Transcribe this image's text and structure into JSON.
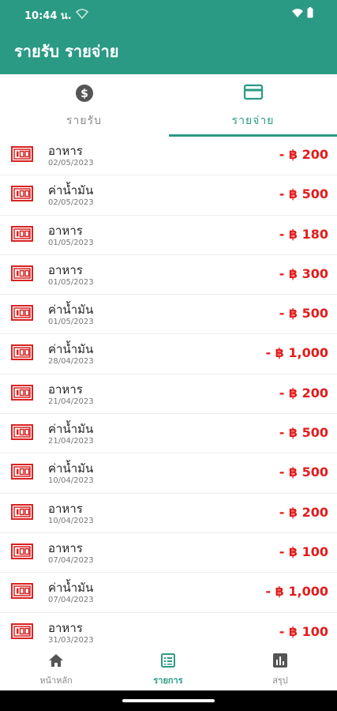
{
  "status_bar": {
    "time": "10:44 น."
  },
  "app_bar": {
    "title": "รายรับ รายจ่าย"
  },
  "tabs": [
    {
      "label": "รายรับ",
      "icon": "dollar-circle-icon",
      "active": false
    },
    {
      "label": "รายจ่าย",
      "icon": "credit-card-icon",
      "active": true
    }
  ],
  "colors": {
    "primary": "#2a9a84",
    "expense": "#e41b1b"
  },
  "transactions": [
    {
      "name": "อาหาร",
      "date": "02/05/2023",
      "amount": "- ฿ 200",
      "icon": "money-bill-icon"
    },
    {
      "name": "ค่าน้ำมัน",
      "date": "02/05/2023",
      "amount": "- ฿ 500",
      "icon": "money-bill-icon"
    },
    {
      "name": "อาหาร",
      "date": "01/05/2023",
      "amount": "- ฿ 180",
      "icon": "money-bill-icon"
    },
    {
      "name": "อาหาร",
      "date": "01/05/2023",
      "amount": "- ฿ 300",
      "icon": "money-bill-icon"
    },
    {
      "name": "ค่าน้ำมัน",
      "date": "01/05/2023",
      "amount": "- ฿ 500",
      "icon": "money-bill-icon"
    },
    {
      "name": "ค่าน้ำมัน",
      "date": "28/04/2023",
      "amount": "- ฿ 1,000",
      "icon": "money-bill-icon"
    },
    {
      "name": "อาหาร",
      "date": "21/04/2023",
      "amount": "- ฿ 200",
      "icon": "money-bill-icon"
    },
    {
      "name": "ค่าน้ำมัน",
      "date": "21/04/2023",
      "amount": "- ฿ 500",
      "icon": "money-bill-icon"
    },
    {
      "name": "ค่าน้ำมัน",
      "date": "10/04/2023",
      "amount": "- ฿ 500",
      "icon": "money-bill-icon"
    },
    {
      "name": "อาหาร",
      "date": "10/04/2023",
      "amount": "- ฿ 200",
      "icon": "money-bill-icon"
    },
    {
      "name": "อาหาร",
      "date": "07/04/2023",
      "amount": "- ฿ 100",
      "icon": "money-bill-icon"
    },
    {
      "name": "ค่าน้ำมัน",
      "date": "07/04/2023",
      "amount": "- ฿ 1,000",
      "icon": "money-bill-icon"
    },
    {
      "name": "อาหาร",
      "date": "31/03/2023",
      "amount": "- ฿ 100",
      "icon": "money-bill-icon"
    }
  ],
  "bottom_nav": [
    {
      "label": "หน้าหลัก",
      "icon": "home-icon",
      "active": false
    },
    {
      "label": "รายการ",
      "icon": "list-icon",
      "active": true
    },
    {
      "label": "สรุป",
      "icon": "bar-chart-icon",
      "active": false
    }
  ]
}
